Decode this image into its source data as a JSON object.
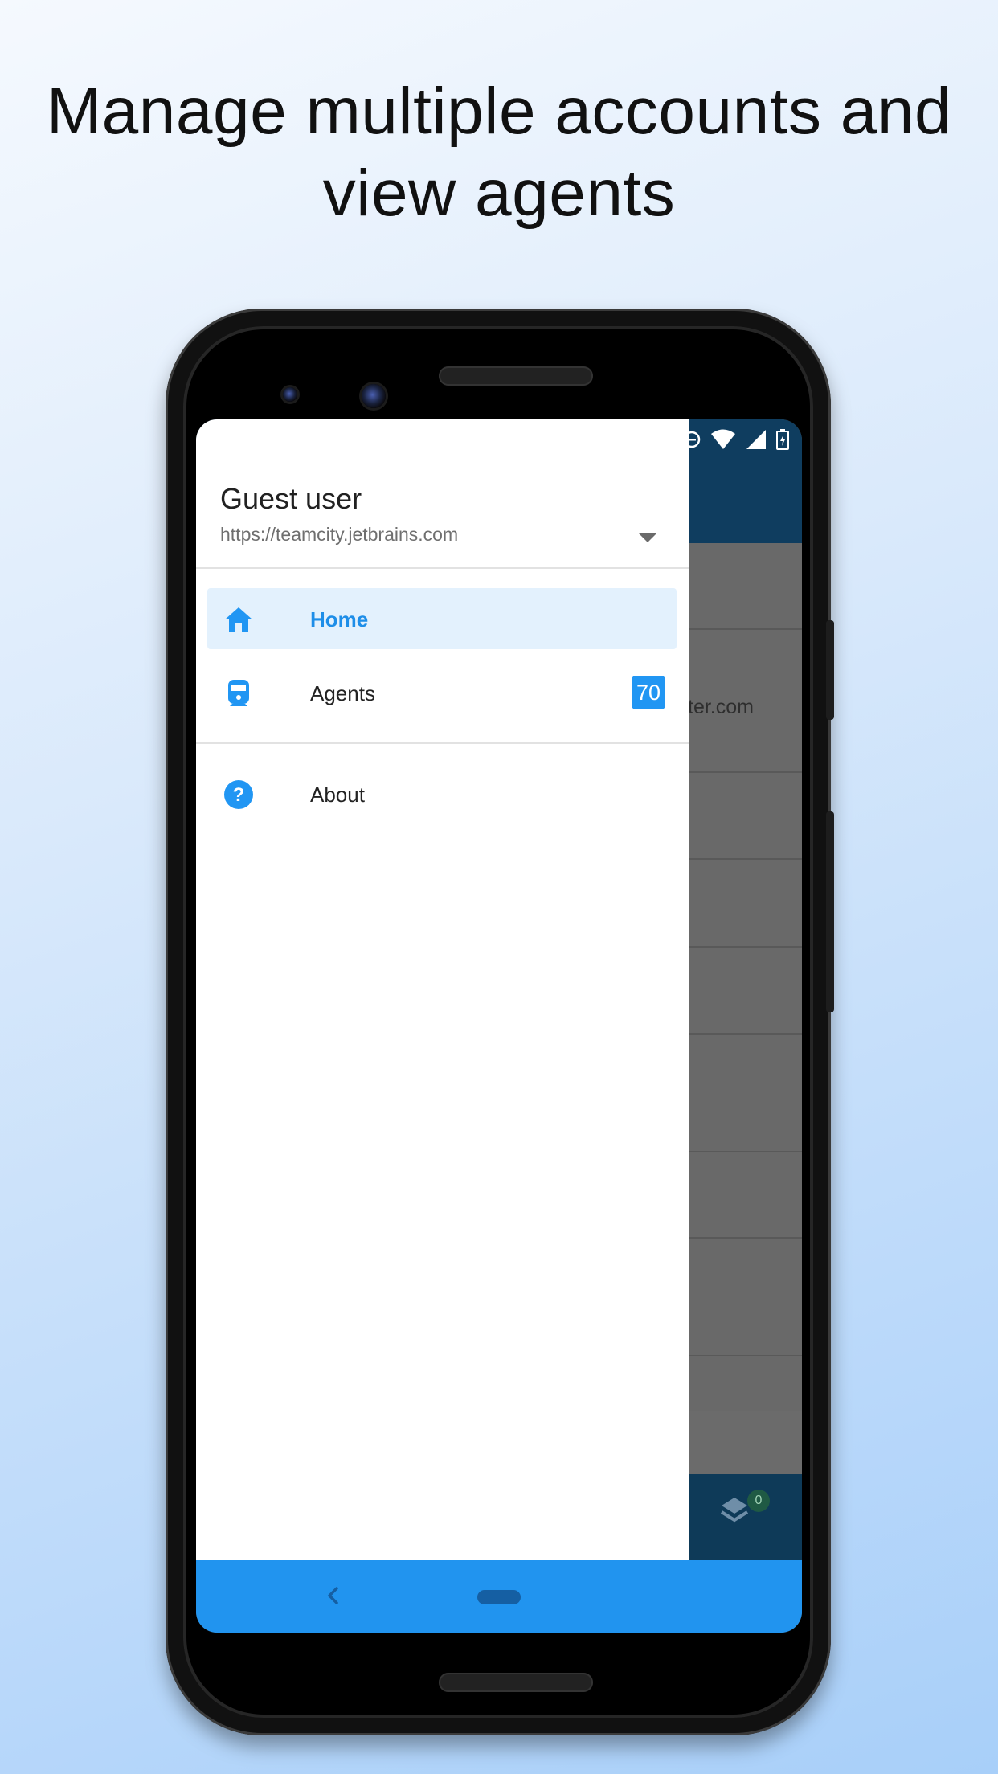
{
  "headline": {
    "line1": "Manage multiple accounts and",
    "line2": "view agents"
  },
  "drawer": {
    "user_name": "Guest user",
    "server_url": "https://teamcity.jetbrains.com",
    "dropdown_icon": "arrow-drop-down-icon",
    "items": [
      {
        "label": "Home",
        "icon": "home-icon",
        "active": true
      },
      {
        "label": "Agents",
        "icon": "agent-train-icon",
        "active": false,
        "badge": "70"
      },
      {
        "label": "About",
        "icon": "help-circle-icon",
        "active": false
      }
    ]
  },
  "background_app": {
    "partial_url_text": "ter.com",
    "queue_badge": "0"
  },
  "colors": {
    "accent": "#2196f3",
    "active_item_bg": "#e3f1fd",
    "app_bar": "#0f3d5f",
    "nav_bar": "#2194ef"
  }
}
